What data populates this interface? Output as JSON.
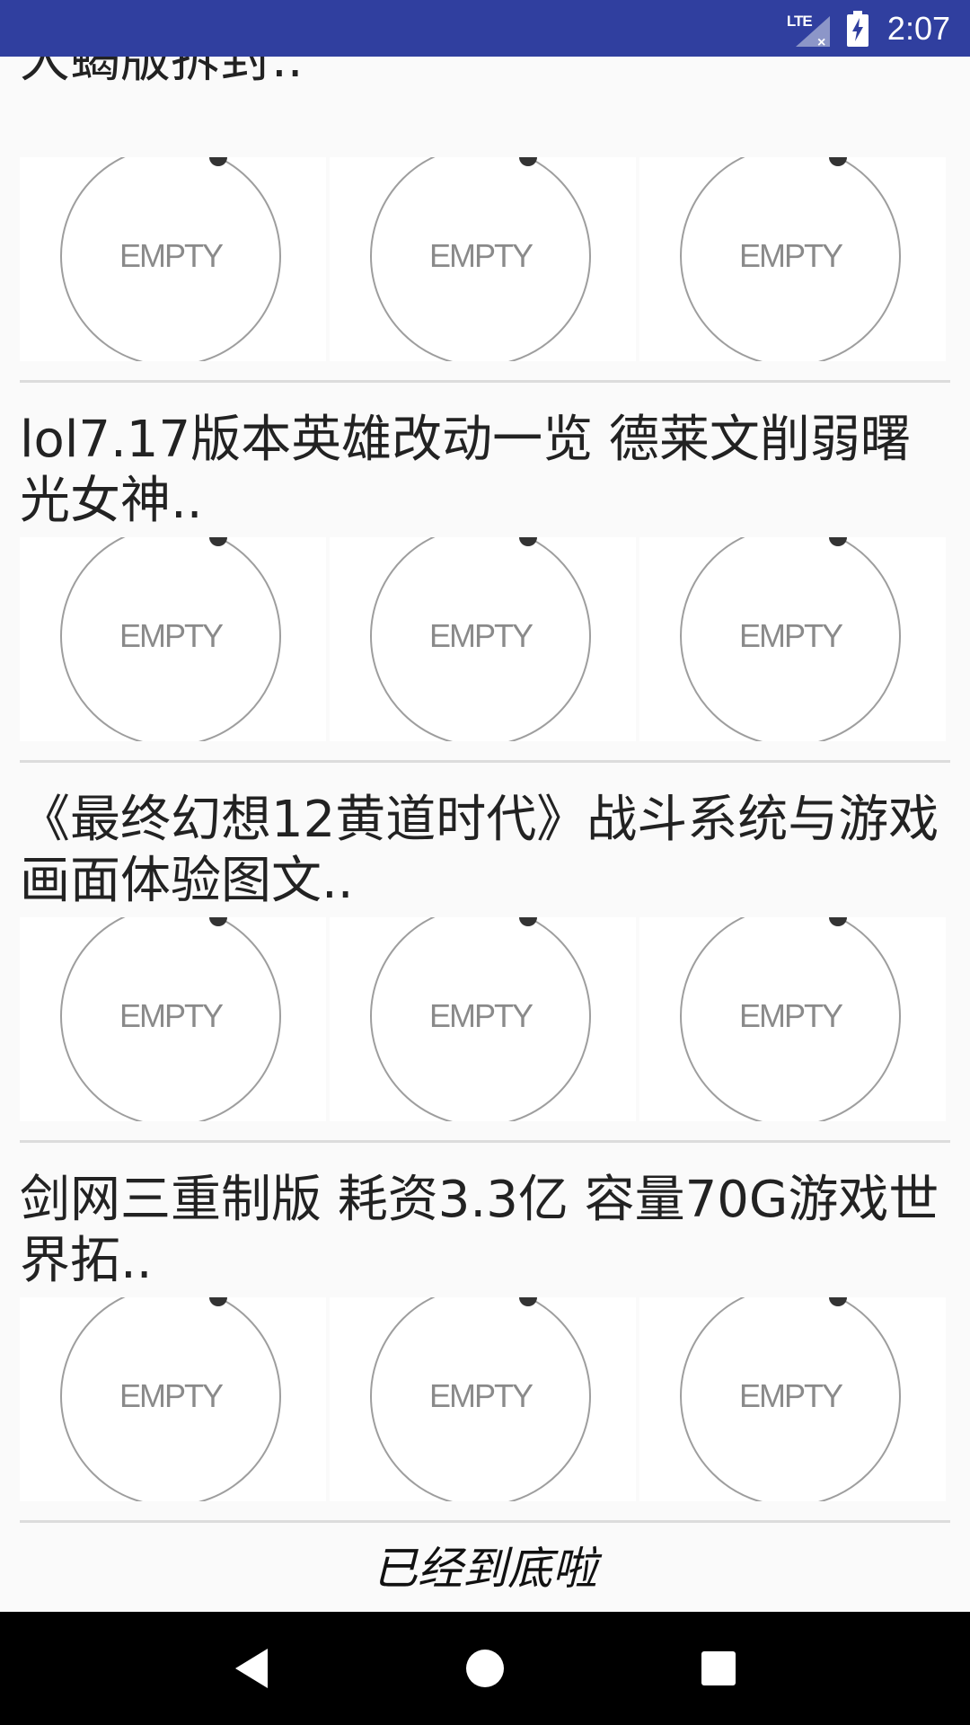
{
  "status_bar": {
    "network_label": "LTE",
    "time": "2:07",
    "icons": [
      "signal-icon",
      "battery-charging-icon"
    ]
  },
  "feed": {
    "items": [
      {
        "title": "大蝎版拆封..",
        "images": [
          {
            "label": "EMPTY"
          },
          {
            "label": "EMPTY"
          },
          {
            "label": "EMPTY"
          }
        ]
      },
      {
        "title": "lol7.17版本英雄改动一览 德莱文削弱曙光女神..",
        "images": [
          {
            "label": "EMPTY"
          },
          {
            "label": "EMPTY"
          },
          {
            "label": "EMPTY"
          }
        ]
      },
      {
        "title": "《最终幻想12黄道时代》战斗系统与游戏画面体验图文..",
        "images": [
          {
            "label": "EMPTY"
          },
          {
            "label": "EMPTY"
          },
          {
            "label": "EMPTY"
          }
        ]
      },
      {
        "title": "剑网三重制版 耗资3.3亿 容量70G游戏世界拓..",
        "images": [
          {
            "label": "EMPTY"
          },
          {
            "label": "EMPTY"
          },
          {
            "label": "EMPTY"
          }
        ]
      }
    ],
    "end_message": "已经到底啦"
  },
  "nav_bar": {
    "icons": [
      "back-icon",
      "home-icon",
      "recents-icon"
    ]
  },
  "colors": {
    "status_bar": "#303f9f",
    "background": "#fafafa",
    "nav_bar": "#000000"
  }
}
